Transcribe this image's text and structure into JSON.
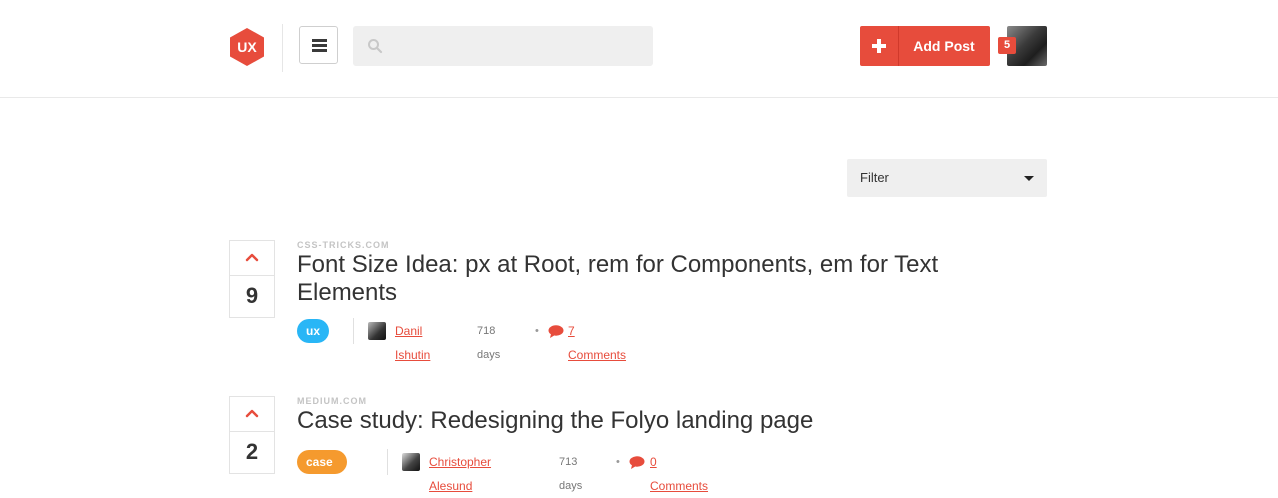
{
  "header": {
    "logo_text": "UX",
    "search": {
      "value": "",
      "placeholder": ""
    },
    "add_post_label": "Add Post",
    "notification_count": "5"
  },
  "filter": {
    "selected": "Filter"
  },
  "posts": [
    {
      "source": "CSS-TRICKS.COM",
      "title": "Font Size Idea: px at Root, rem for Components, em for Text Elements",
      "votes": "9",
      "tag": "ux ui",
      "author": "Danil Ishutin",
      "age": "718 days",
      "comments": "7 Comments"
    },
    {
      "source": "MEDIUM.COM",
      "title": "Case study: Redesigning the Folyo landing page",
      "votes": "2",
      "tag": "case study",
      "author": "Christopher Alesund",
      "age": "713 days",
      "comments": "0 Comments"
    }
  ],
  "colors": {
    "accent": "#e74c3c",
    "tag_ux_ui": "#29b6f6",
    "tag_case_study": "#f59a2e"
  },
  "icons": [
    "ux-logo-icon",
    "hamburger-menu-icon",
    "search-icon",
    "plus-icon",
    "upvote-chevron-icon",
    "comment-bubble-icon",
    "caret-down-icon"
  ]
}
